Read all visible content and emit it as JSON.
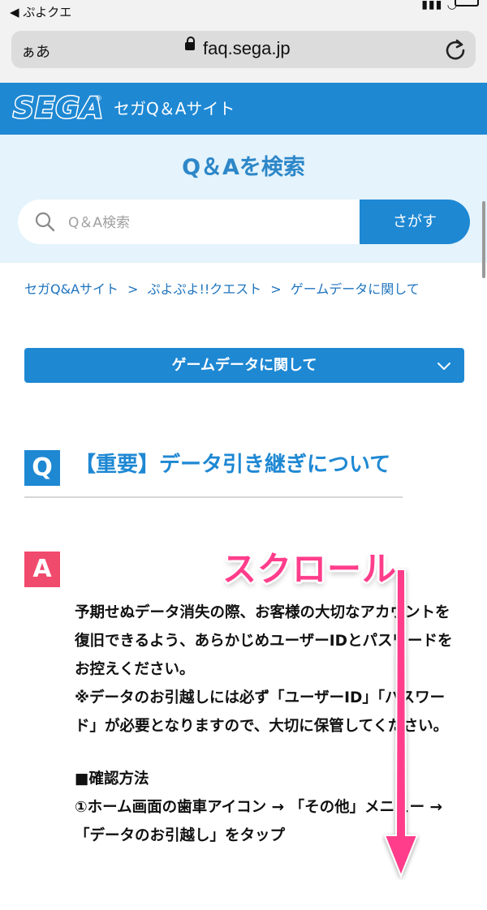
{
  "status": {
    "back_label": "◀ ぷよクエ"
  },
  "browser": {
    "aa_label": "ぁあ",
    "url": "faq.sega.jp"
  },
  "header": {
    "logo_text": "SEGA",
    "site_title": "セガQ＆Aサイト"
  },
  "search": {
    "heading": "Q＆Aを検索",
    "placeholder": "Q＆A検索",
    "button_label": "さがす"
  },
  "breadcrumb": [
    "セガQ&Aサイト",
    "ぷよぷよ!!クエスト",
    "ゲームデータに関して"
  ],
  "category": {
    "label": "ゲームデータに関して"
  },
  "question": {
    "badge": "Q",
    "title": "【重要】データ引き継ぎについて"
  },
  "answer": {
    "badge": "A",
    "paragraph1": "予期せぬデータ消失の際、お客様の大切なアカウントを復旧できるよう、あらかじめユーザーIDとパスワードをお控えください。",
    "paragraph2": "※データのお引越しには必ず「ユーザーID」「パスワード」が必要となりますので、大切に保管してください。",
    "section_heading": "■確認方法",
    "step1": "①ホーム画面の歯車アイコン → 「その他」メニュー → 「データのお引越し」をタップ"
  },
  "annotation": {
    "scroll_label": "スクロール",
    "color": "#ff3d8b"
  },
  "colors": {
    "brand_blue": "#1e88d3",
    "answer_pink": "#f04a6d",
    "search_band": "#e4f3fc"
  }
}
